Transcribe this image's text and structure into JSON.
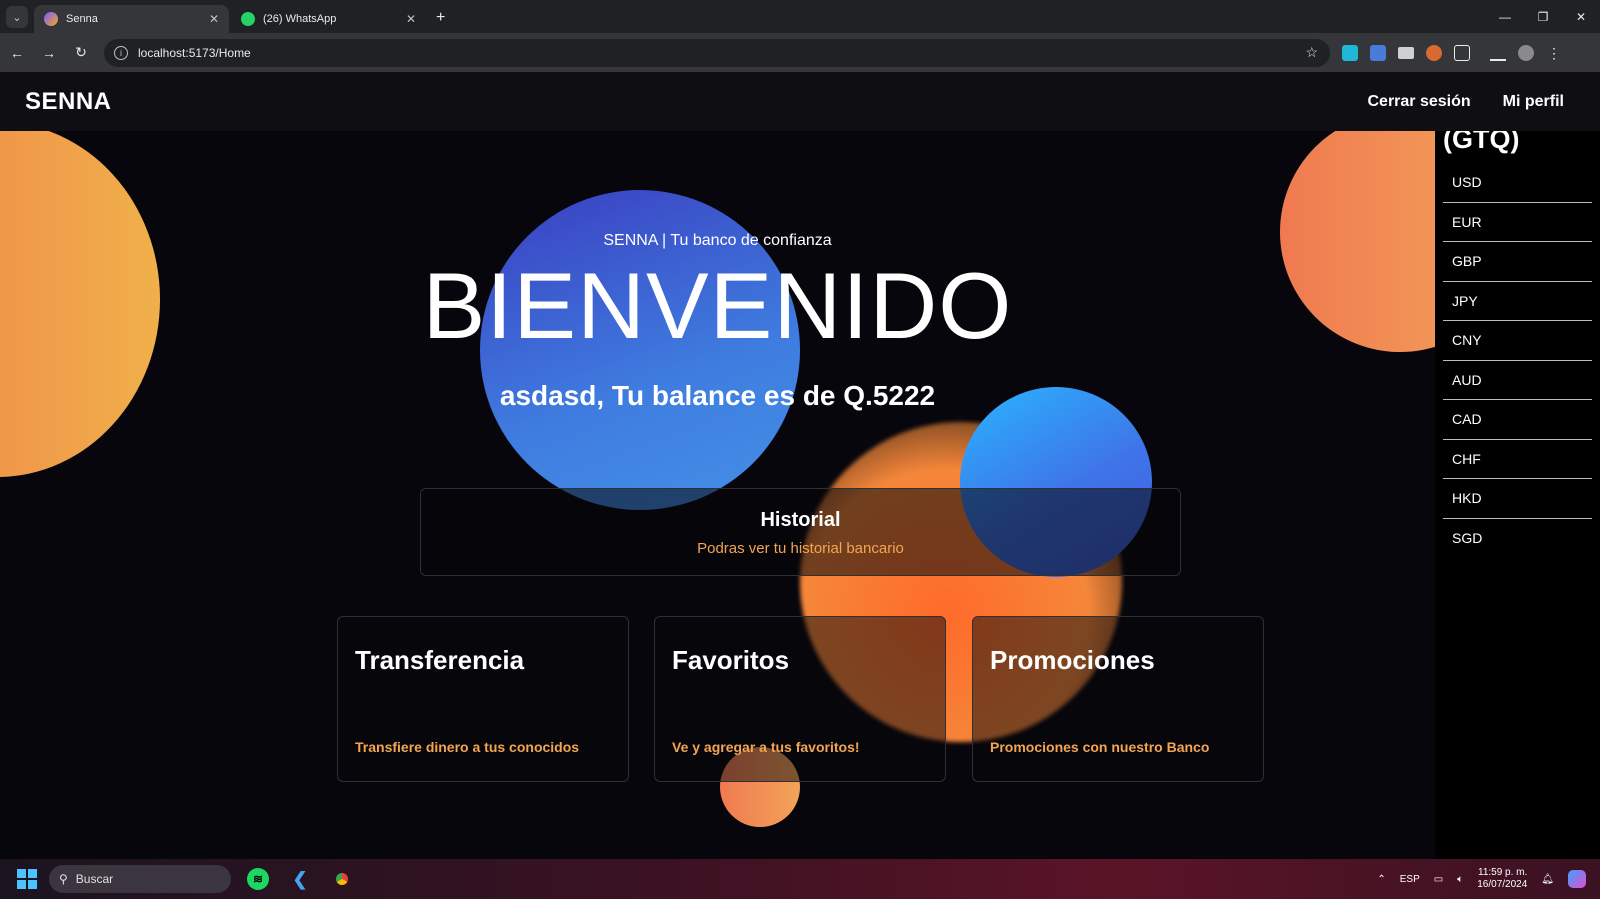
{
  "browser": {
    "tabs": [
      {
        "title": "Senna",
        "active": true
      },
      {
        "title": "(26) WhatsApp",
        "active": false
      }
    ],
    "url": "localhost:5173/Home"
  },
  "app": {
    "brand": "SENNA",
    "nav": {
      "logout": "Cerrar sesión",
      "profile": "Mi perfil"
    },
    "hero": {
      "subtitle": "SENNA | Tu banco de confianza",
      "title": "BIENVENIDO",
      "balance": "asdasd, Tu balance es de Q.5222"
    },
    "history": {
      "title": "Historial",
      "description": "Podras ver tu historial bancario"
    },
    "cards": [
      {
        "title": "Transferencia",
        "description": "Transfiere dinero a tus conocidos"
      },
      {
        "title": "Favoritos",
        "description": "Ve y agregar a tus favoritos!"
      },
      {
        "title": "Promociones",
        "description": "Promociones con nuestro Banco"
      }
    ],
    "sidebar": {
      "title": "Cambio a Quetzales (GTQ)",
      "currencies": [
        "USD",
        "EUR",
        "GBP",
        "JPY",
        "CNY",
        "AUD",
        "CAD",
        "CHF",
        "HKD",
        "SGD"
      ]
    }
  },
  "taskbar": {
    "search_placeholder": "Buscar",
    "language": "ESP",
    "time": "11:59 p. m.",
    "date": "16/07/2024"
  },
  "colors": {
    "accent": "#f2a553",
    "background": "#07060c"
  }
}
